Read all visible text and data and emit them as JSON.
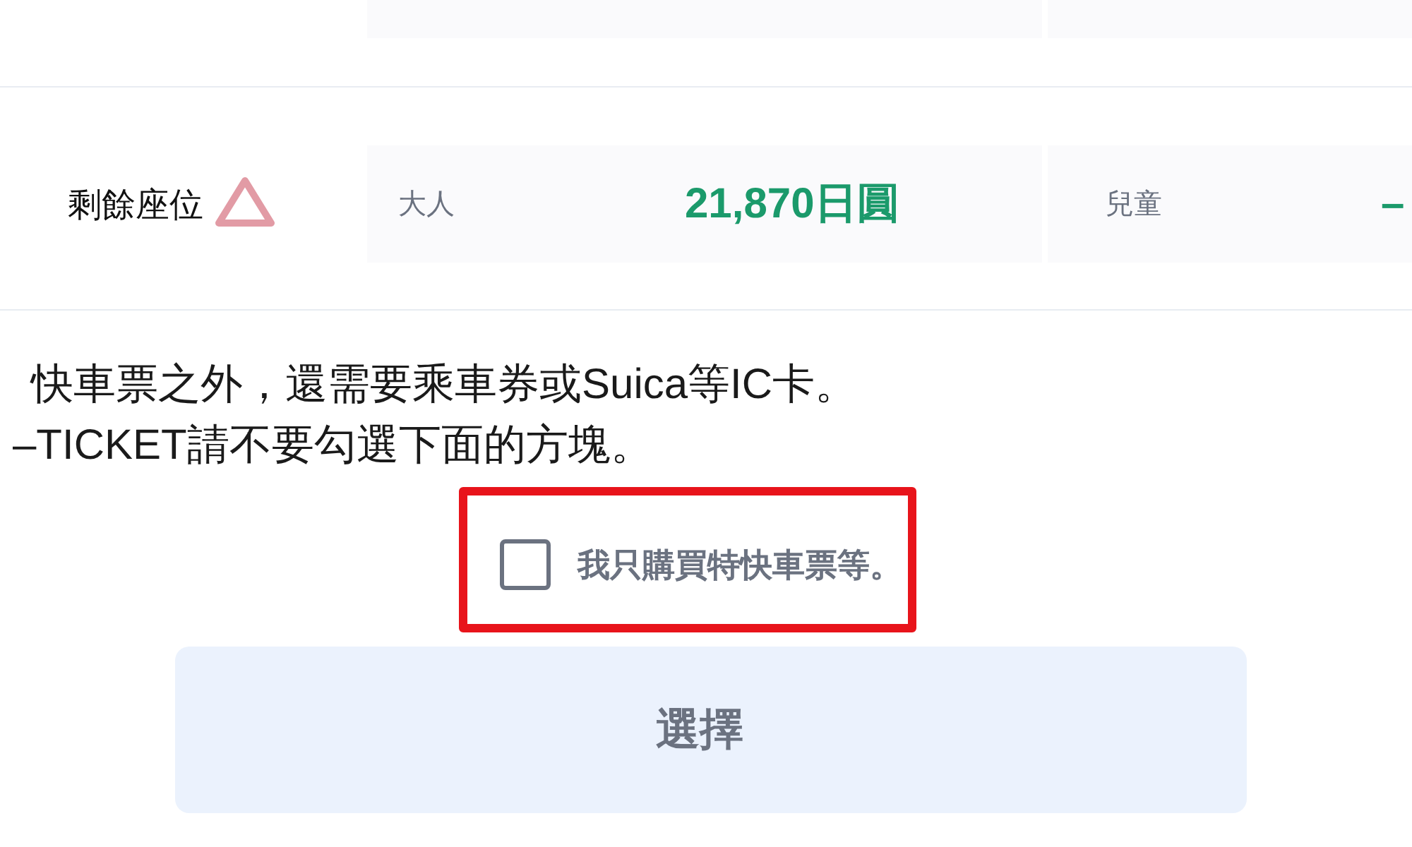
{
  "fare_rows": [
    {
      "label": "剩餘座位",
      "few_seats_left": true,
      "fares": [
        {
          "passenger": "大人",
          "price": "21,870日圓"
        },
        {
          "passenger": "兒童",
          "price": "–"
        }
      ]
    }
  ],
  "notes": [
    "快車票之外，還需要乘車券或Suica等IC卡。",
    "–TICKET請不要勾選下面的方塊。"
  ],
  "option": {
    "label": "我只購買特快車票等。",
    "checked": false,
    "highlighted": true
  },
  "select_button": {
    "label": "選擇",
    "disabled": true
  }
}
